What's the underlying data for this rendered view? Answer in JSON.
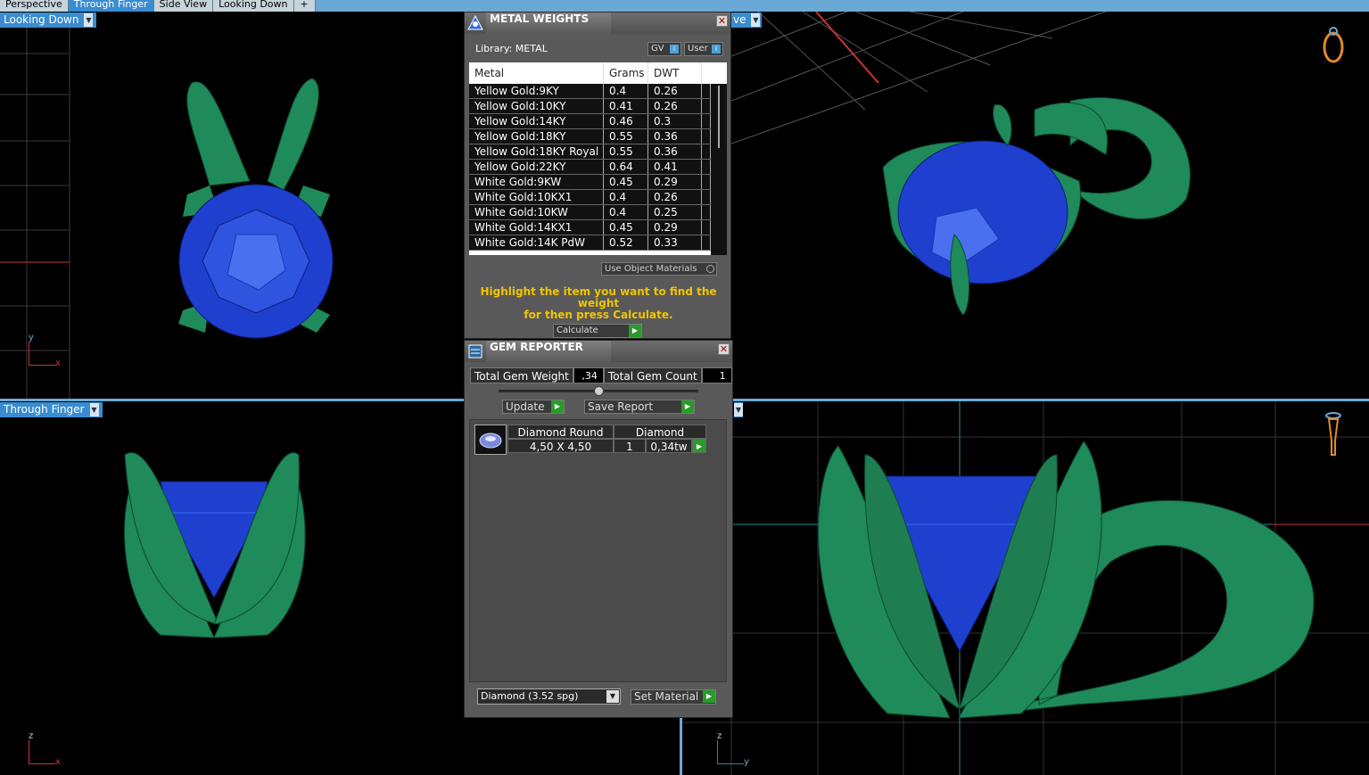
{
  "tabs": [
    "Perspective",
    "Through Finger",
    "Side View",
    "Looking Down",
    "+"
  ],
  "active_tab": 1,
  "viewports": {
    "top_left": {
      "label": "Looking Down",
      "axes": [
        "y",
        "x"
      ]
    },
    "top_right": {
      "label": "ve"
    },
    "bottom_left": {
      "label": "Through Finger",
      "axes": [
        "z",
        "x"
      ]
    },
    "bottom_right": {
      "axes": [
        "z",
        "y"
      ]
    }
  },
  "metal_weights": {
    "title": "METAL WEIGHTS",
    "library": "Library: METAL",
    "toggle_gv": "GV",
    "toggle_user": "User",
    "columns": [
      "Metal",
      "Grams",
      "DWT"
    ],
    "rows": [
      [
        "Yellow Gold:9KY",
        "0.4",
        "0.26"
      ],
      [
        "Yellow Gold:10KY",
        "0.41",
        "0.26"
      ],
      [
        "Yellow Gold:14KY",
        "0.46",
        "0.3"
      ],
      [
        "Yellow Gold:18KY",
        "0.55",
        "0.36"
      ],
      [
        "Yellow Gold:18KY Royal",
        "0.55",
        "0.36"
      ],
      [
        "Yellow Gold:22KY",
        "0.64",
        "0.41"
      ],
      [
        "White Gold:9KW",
        "0.45",
        "0.29"
      ],
      [
        "White Gold:10KX1",
        "0.4",
        "0.26"
      ],
      [
        "White Gold:10KW",
        "0.4",
        "0.25"
      ],
      [
        "White Gold:14KX1",
        "0.45",
        "0.29"
      ],
      [
        "White Gold:14K PdW",
        "0.52",
        "0.33"
      ]
    ],
    "use_object_materials": "Use Object Materials",
    "hint_line1": "Highlight the item you want to find the weight",
    "hint_line2": "for then press Calculate.",
    "calculate": "Calculate"
  },
  "gem_reporter": {
    "title": "GEM REPORTER",
    "total_weight_label": "Total Gem Weight",
    "total_weight_value": ",34",
    "total_count_label": "Total Gem Count",
    "total_count_value": "1",
    "update": "Update",
    "save_report": "Save Report",
    "gem": {
      "shape": "Diamond Round",
      "material": "Diamond",
      "size": "4,50 X 4,50",
      "count": "1",
      "weight": "0,34tw"
    },
    "material_select": "Diamond    (3.52 spg)",
    "set_material": "Set Material"
  },
  "colors": {
    "metal": "#1f8a5a",
    "gem": "#1f3fcf",
    "label_bg": "#3a8cd0",
    "hint": "#f2c400"
  }
}
